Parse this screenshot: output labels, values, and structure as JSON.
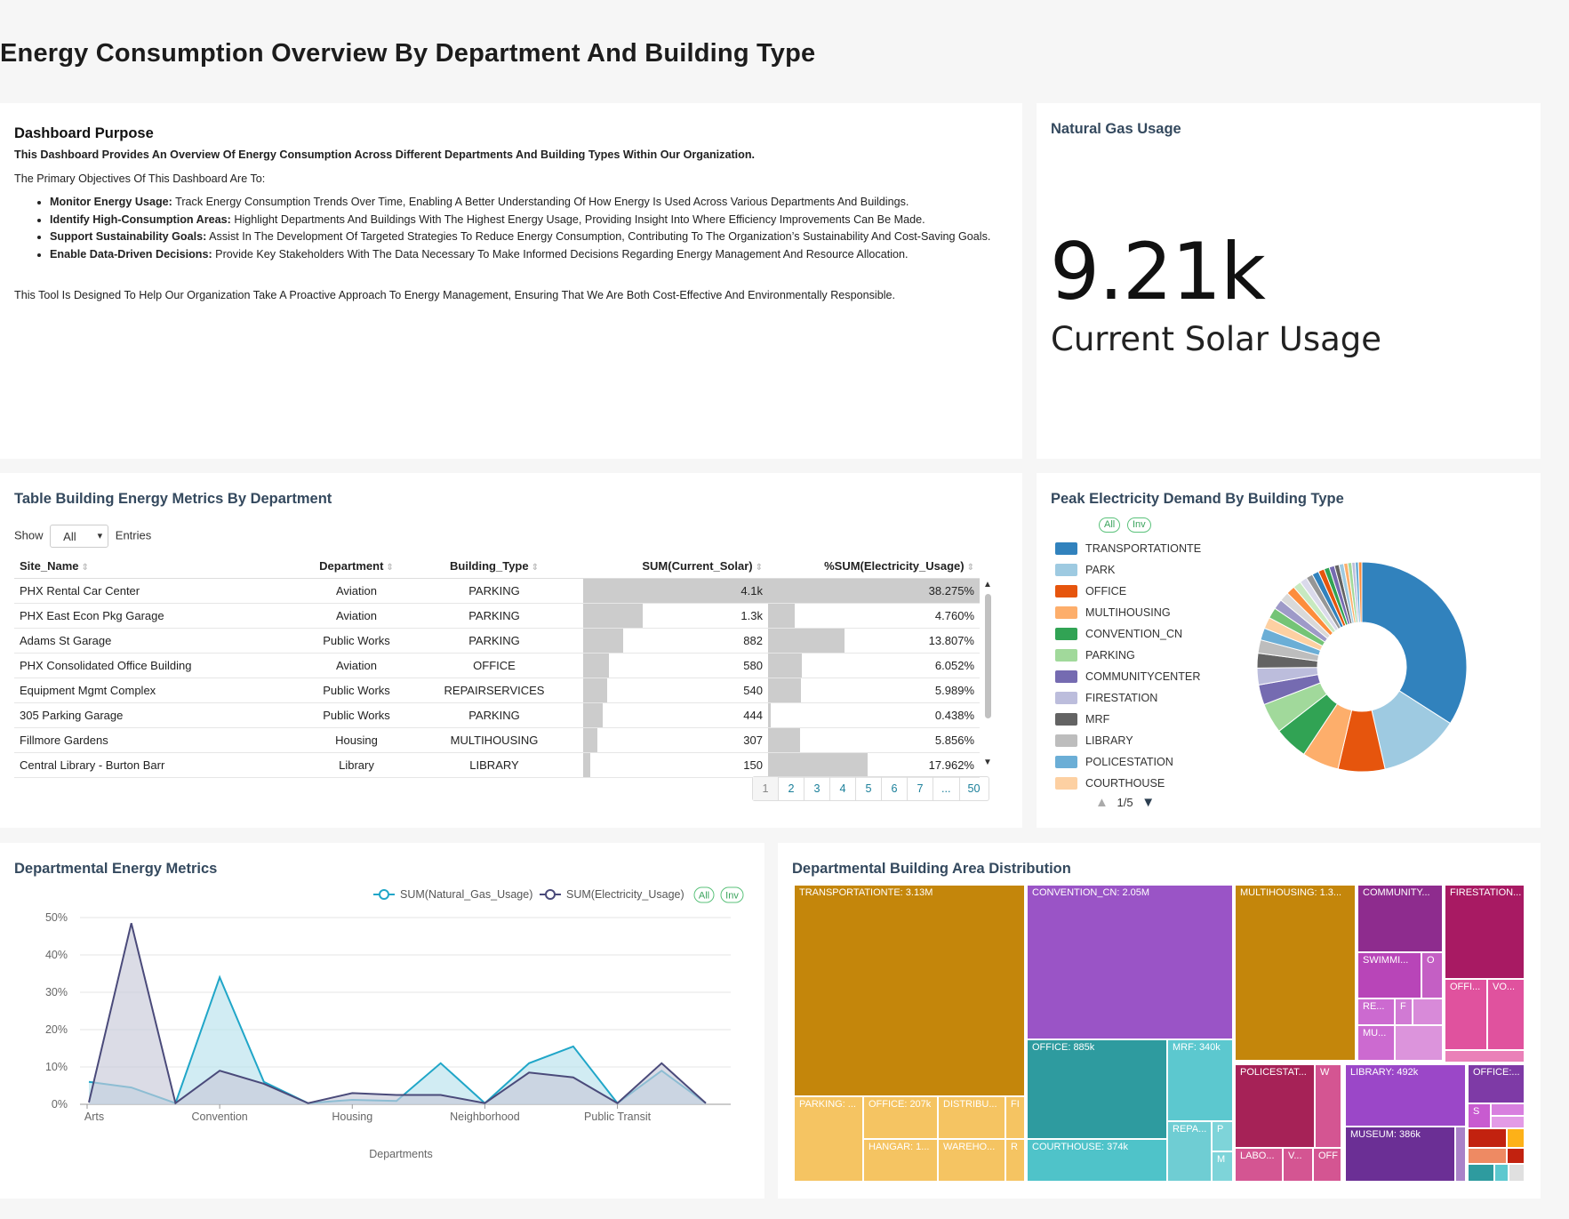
{
  "page_title": "Energy Consumption Overview By Department And Building Type",
  "purpose": {
    "heading": "Dashboard Purpose",
    "intro": "This Dashboard Provides An Overview Of Energy Consumption Across Different Departments And Building Types Within Our Organization.",
    "objectives_lead": "The Primary Objectives Of This Dashboard Are To:",
    "bullets": [
      {
        "bold": "Monitor Energy Usage:",
        "text": " Track Energy Consumption Trends Over Time, Enabling A Better Understanding Of How Energy Is Used Across Various Departments And Buildings."
      },
      {
        "bold": "Identify High-Consumption Areas:",
        "text": " Highlight Departments And Buildings With The Highest Energy Usage, Providing Insight Into Where Efficiency Improvements Can Be Made."
      },
      {
        "bold": "Support Sustainability Goals:",
        "text": " Assist In The Development Of Targeted Strategies To Reduce Energy Consumption, Contributing To The Organization’s Sustainability And Cost-Saving Goals."
      },
      {
        "bold": "Enable Data-Driven Decisions:",
        "text": " Provide Key Stakeholders With The Data Necessary To Make Informed Decisions Regarding Energy Management And Resource Allocation."
      }
    ],
    "closing": "This Tool Is Designed To Help Our Organization Take A Proactive Approach To Energy Management, Ensuring That We Are Both Cost-Effective And Environmentally Responsible."
  },
  "kpi": {
    "title": "Natural Gas Usage",
    "value": "9.21k",
    "subtitle": "Current Solar Usage"
  },
  "table": {
    "title": "Table Building Energy Metrics By Department",
    "show_label": "Show",
    "show_value": "All",
    "entries_label": "Entries",
    "columns": [
      "Site_Name",
      "Department",
      "Building_Type",
      "SUM(Current_Solar)",
      "%SUM(Electricity_Usage)"
    ],
    "rows": [
      {
        "site": "PHX Rental Car Center",
        "dept": "Aviation",
        "type": "PARKING",
        "solar": "4.1k",
        "solar_frac": 1.0,
        "elec": "38.275%",
        "elec_frac": 1.0
      },
      {
        "site": "PHX East Econ Pkg Garage",
        "dept": "Aviation",
        "type": "PARKING",
        "solar": "1.3k",
        "solar_frac": 0.32,
        "elec": "4.760%",
        "elec_frac": 0.124
      },
      {
        "site": "Adams St Garage",
        "dept": "Public Works",
        "type": "PARKING",
        "solar": "882",
        "solar_frac": 0.215,
        "elec": "13.807%",
        "elec_frac": 0.361
      },
      {
        "site": "PHX Consolidated Office Building",
        "dept": "Aviation",
        "type": "OFFICE",
        "solar": "580",
        "solar_frac": 0.141,
        "elec": "6.052%",
        "elec_frac": 0.158
      },
      {
        "site": "Equipment Mgmt Complex",
        "dept": "Public Works",
        "type": "REPAIRSERVICES",
        "solar": "540",
        "solar_frac": 0.132,
        "elec": "5.989%",
        "elec_frac": 0.156
      },
      {
        "site": "305 Parking Garage",
        "dept": "Public Works",
        "type": "PARKING",
        "solar": "444",
        "solar_frac": 0.108,
        "elec": "0.438%",
        "elec_frac": 0.011
      },
      {
        "site": "Fillmore Gardens",
        "dept": "Housing",
        "type": "MULTIHOUSING",
        "solar": "307",
        "solar_frac": 0.075,
        "elec": "5.856%",
        "elec_frac": 0.153
      },
      {
        "site": "Central Library - Burton Barr",
        "dept": "Library",
        "type": "LIBRARY",
        "solar": "150",
        "solar_frac": 0.037,
        "elec": "17.962%",
        "elec_frac": 0.469
      }
    ],
    "pages": [
      "1",
      "2",
      "3",
      "4",
      "5",
      "6",
      "7",
      "...",
      "50"
    ]
  },
  "donut": {
    "title": "Peak Electricity Demand By Building Type",
    "all_label": "All",
    "inv_label": "Inv",
    "legend_page": "1/5",
    "legend": [
      {
        "name": "TRANSPORTATIONTE",
        "color": "#3182bd"
      },
      {
        "name": "PARK",
        "color": "#9ecae1"
      },
      {
        "name": "OFFICE",
        "color": "#e6550d"
      },
      {
        "name": "MULTIHOUSING",
        "color": "#fdae6b"
      },
      {
        "name": "CONVENTION_CN",
        "color": "#31a354"
      },
      {
        "name": "PARKING",
        "color": "#a1d99b"
      },
      {
        "name": "COMMUNITYCENTER",
        "color": "#756bb1"
      },
      {
        "name": "FIRESTATION",
        "color": "#bcbddc"
      },
      {
        "name": "MRF",
        "color": "#636363"
      },
      {
        "name": "LIBRARY",
        "color": "#bdbdbd"
      },
      {
        "name": "POLICESTATION",
        "color": "#6baed6"
      },
      {
        "name": "COURTHOUSE",
        "color": "#fdd0a2"
      }
    ],
    "slices": [
      0.33,
      0.12,
      0.07,
      0.055,
      0.05,
      0.045,
      0.03,
      0.025,
      0.022,
      0.02,
      0.018,
      0.017,
      0.016,
      0.015,
      0.014,
      0.013,
      0.012,
      0.011,
      0.01,
      0.01,
      0.009,
      0.008,
      0.008,
      0.007,
      0.007,
      0.006,
      0.006,
      0.005,
      0.005,
      0.005
    ],
    "slice_colors": [
      "#3182bd",
      "#9ecae1",
      "#e6550d",
      "#fdae6b",
      "#31a354",
      "#a1d99b",
      "#756bb1",
      "#bcbddc",
      "#636363",
      "#bdbdbd",
      "#6baed6",
      "#fdd0a2",
      "#74c476",
      "#9e9ac8",
      "#d9d9d9",
      "#fd8d3c",
      "#c7e9c0",
      "#dadaeb",
      "#969696",
      "#3182bd",
      "#e6550d",
      "#31a354",
      "#756bb1",
      "#636363",
      "#9ecae1",
      "#fdae6b",
      "#a1d99b",
      "#bcbddc",
      "#6baed6",
      "#fd8d3c"
    ]
  },
  "line": {
    "title": "Departmental Energy Metrics",
    "all_label": "All",
    "inv_label": "Inv"
  },
  "treemap": {
    "title": "Departmental Building Area Distribution",
    "labels": {
      "t1": "TRANSPORTATIONTE: 3.13M",
      "t2": "CONVENTION_CN: 2.05M",
      "t3": "MULTIHOUSING: 1.3...",
      "t4": "COMMUNITY...",
      "t5": "FIRESTATION...",
      "t6": "SWIMMI...",
      "t7": "O",
      "t8": "RE...",
      "t9": "F",
      "t10": "MU...",
      "t11": "OFFI...",
      "t12": "VO...",
      "t13": "PARKING: ...",
      "t14": "OFFICE: 207k",
      "t15": "DISTRIBU...",
      "t16": "FI",
      "t17": "HANGAR: 1...",
      "t18": "WAREHO...",
      "t19": "R",
      "t20": "OFFICE: 885k",
      "t21": "MRF: 340k",
      "t22": "REPA...",
      "t23": "P",
      "t24": "M",
      "t25": "COURTHOUSE: 374k",
      "t26": "POLICESTAT...",
      "t27": "W",
      "t28": "LABO...",
      "t29": "V...",
      "t30": "OFF",
      "t31": "LIBRARY: 492k",
      "t32": "OFFICE:...",
      "t33": "S",
      "t34": "MUSEUM: 386k"
    }
  },
  "chart_data": {
    "type": "area",
    "x": [
      "Arts",
      "",
      "",
      "Convention",
      "",
      "",
      "Housing",
      "",
      "",
      "Neighborhood",
      "",
      "",
      "Public Transit",
      "",
      "",
      ""
    ],
    "xtick_labels": [
      "Arts",
      "Convention",
      "Housing",
      "Neighborhood",
      "Public Transit"
    ],
    "xlabel": "Departments",
    "ylabel": "",
    "yticks": [
      "0%",
      "10%",
      "20%",
      "30%",
      "40%",
      "50%"
    ],
    "ylim": [
      0,
      50
    ],
    "series": [
      {
        "name": "SUM(Natural_Gas_Usage)",
        "color": "#20a6c8",
        "fill": "#b9e2ec",
        "values": [
          6,
          4.5,
          0.3,
          34,
          6,
          0.3,
          1.2,
          0.9,
          11,
          0.3,
          11,
          15.5,
          0.3,
          9,
          0.3
        ]
      },
      {
        "name": "SUM(Electricity_Usage)",
        "color": "#4a4a7a",
        "fill": "#c7c9d8",
        "values": [
          0.5,
          48.5,
          0.3,
          9,
          5.5,
          0.3,
          3,
          2.5,
          2.5,
          0.3,
          8.5,
          7.2,
          0.3,
          11,
          0.3
        ]
      }
    ]
  }
}
